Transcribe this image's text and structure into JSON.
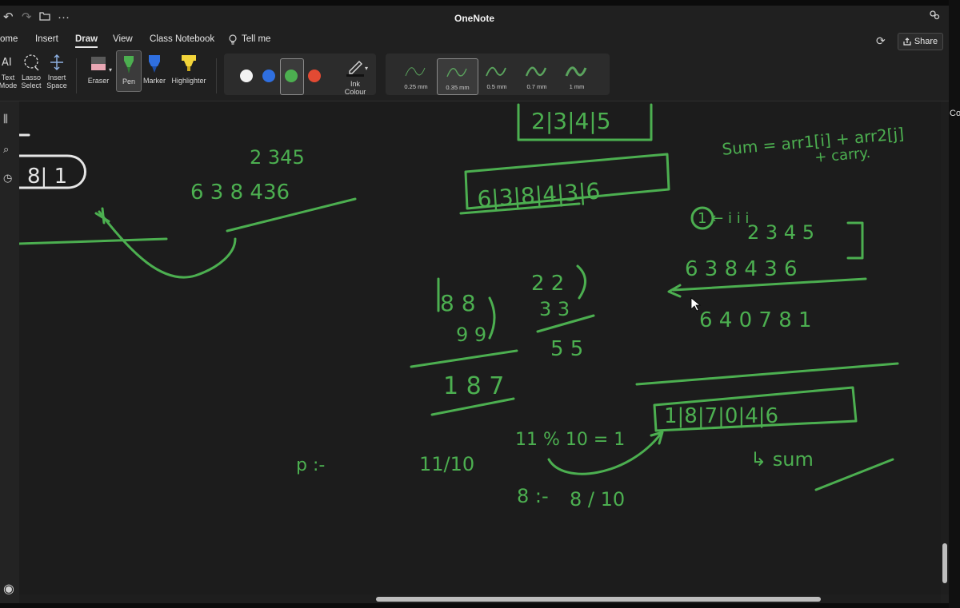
{
  "titlebar": {
    "title": "OneNote",
    "undo_icon": "undo-icon",
    "redo_icon": "redo-icon",
    "folder_icon": "folder-icon",
    "more_icon": "more-icon"
  },
  "menu": {
    "items": [
      "ome",
      "Insert",
      "Draw",
      "View",
      "Class Notebook",
      "Tell me"
    ],
    "active": "Draw",
    "share_label": "Share"
  },
  "ribbon": {
    "text_mode_label": [
      "Text",
      "Mode"
    ],
    "lasso_label": [
      "Lasso",
      "Select"
    ],
    "insert_space_label": [
      "Insert",
      "Space"
    ],
    "eraser_label": "Eraser",
    "pen_label": "Pen",
    "marker_label": "Marker",
    "highlighter_label": "Highlighter",
    "colors": [
      "#f2f2f2",
      "#2f6fe0",
      "#4caf50",
      "#e24a33"
    ],
    "selected_color": "#4caf50",
    "ink_colour_label": [
      "Ink",
      "Colour"
    ],
    "thicknesses": [
      "0.25 mm",
      "0.35 mm",
      "0.5 mm",
      "0.7 mm",
      "1 mm"
    ],
    "selected_thickness": "0.35 mm"
  },
  "canvas_text": {
    "array_top": "2|3|4|5",
    "array_mid": "6|3|8|4|3|6",
    "nums_left_top": "2 345",
    "nums_left_bottom": "6 3 8 436",
    "left_box": "8| 1",
    "sum_formula_1": "Sum = arr1[i] + arr2[j]",
    "sum_formula_2": "+ carry.",
    "idx_label": "1 ← i  i  i",
    "row_a": "2 3 4 5",
    "row_b": "6 3  8 4 3 6",
    "row_result": "6 4 0 7 8 1",
    "add_88": "8 8",
    "add_99": "9 9",
    "add_22": "2 2",
    "add_33": "3 3",
    "add_55": "5 5",
    "add_187": "1 8 7",
    "result_box": "1|8|7|0|4|6",
    "mod_note": "11 % 10 = 1",
    "div_note": "11/10",
    "p_note": "p :-",
    "n8_a": "8 :-",
    "n8_b": "8 / 10",
    "sum_note": "↳ sum"
  },
  "right_strip": {
    "label": "Co"
  }
}
